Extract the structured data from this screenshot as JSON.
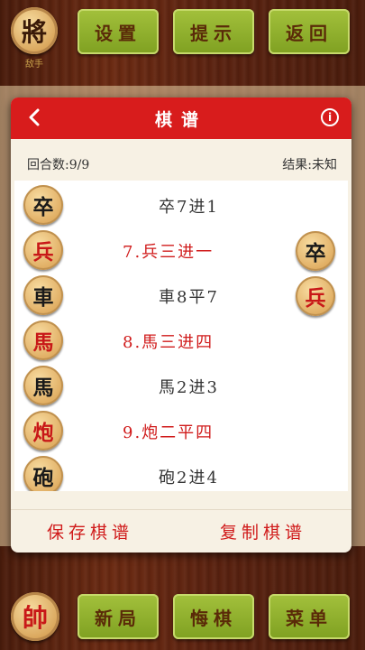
{
  "top": {
    "general_glyph": "將",
    "general_sub": "敌手",
    "buttons": [
      "设置",
      "提示",
      "返回"
    ]
  },
  "dialog": {
    "title": "棋谱",
    "rounds_label": "回合数:9/9",
    "result_label": "结果:未知",
    "moves": [
      {
        "piece": "卒",
        "side": "black",
        "text": "卒7进1"
      },
      {
        "piece": "兵",
        "side": "red",
        "text": "7.兵三进一"
      },
      {
        "piece": "車",
        "side": "black",
        "text": "車8平7"
      },
      {
        "piece": "馬",
        "side": "red",
        "text": "8.馬三进四"
      },
      {
        "piece": "馬",
        "side": "black",
        "text": "馬2进3"
      },
      {
        "piece": "炮",
        "side": "red",
        "text": "9.炮二平四"
      },
      {
        "piece": "砲",
        "side": "black",
        "text": "砲2进4"
      }
    ],
    "captured": [
      {
        "piece": "卒",
        "side": "black"
      },
      {
        "piece": "兵",
        "side": "red"
      }
    ],
    "save_label": "保存棋谱",
    "copy_label": "复制棋谱"
  },
  "bottom": {
    "king_glyph": "帥",
    "buttons": [
      "新局",
      "悔棋",
      "菜单"
    ]
  },
  "colors": {
    "header_red": "#d81c1c",
    "button_green": "#8fb02e",
    "red_text": "#d01b1b"
  }
}
